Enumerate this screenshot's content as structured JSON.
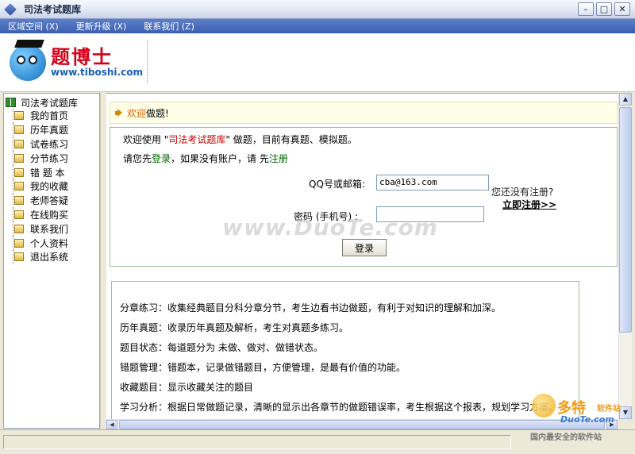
{
  "window": {
    "title": "司法考试题库",
    "buttons": [
      "–",
      "□",
      "✕"
    ]
  },
  "menu": [
    "区域空间 (X)",
    "更新升级 (X)",
    "联系我们 (Z)"
  ],
  "logo": {
    "title": "题博士",
    "url": "www.tiboshi.com"
  },
  "sidebar": {
    "root": "司法考试题库",
    "items": [
      "我的首页",
      "历年真题",
      "试卷练习",
      "分节练习",
      "错 题 本",
      "我的收藏",
      "老师答疑",
      "在线购买",
      "联系我们",
      "个人资料",
      "退出系统"
    ]
  },
  "welcome": {
    "highlight": "欢迎",
    "rest": "做题!"
  },
  "intro": {
    "line1_prefix": "欢迎使用 \"",
    "line1_brand": "司法考试题库",
    "line1_suffix": "\" 做题，目前有真题、模拟题。",
    "line2_prefix": "请您先",
    "line2_login": "登录",
    "line2_middle": "，如果没有账户，请 先",
    "line2_register": "注册"
  },
  "form": {
    "account_label": "QQ号或邮箱:",
    "account_value": "cba@163.com",
    "password_label": "密码 (手机号) :",
    "password_value": "",
    "not_registered": "您还没有注册?",
    "register_now": "立即注册>>",
    "login_button": "登录"
  },
  "info": [
    "分章练习：收集经典题目分科分章分节，考生边看书边做题，有利于对知识的理解和加深。",
    "历年真题：收录历年真题及解析，考生对真题多练习。",
    "题目状态：每道题分为 未做、做对、做错状态。",
    "错题管理：错题本，记录做错题目，方便管理，是最有价值的功能。",
    "收藏题目：显示收藏关注的题目",
    "学习分析：根据日常做题记录，清晰的显示出各章节的做题错误率，考生根据这个报表，规划学习方案。"
  ],
  "watermarks": {
    "center": "www.DuoTe.com",
    "corner_brand": "多特",
    "corner_sub": "软件站",
    "corner_en": "DuoTe.com",
    "corner_slogan": "国内最安全的软件站"
  }
}
